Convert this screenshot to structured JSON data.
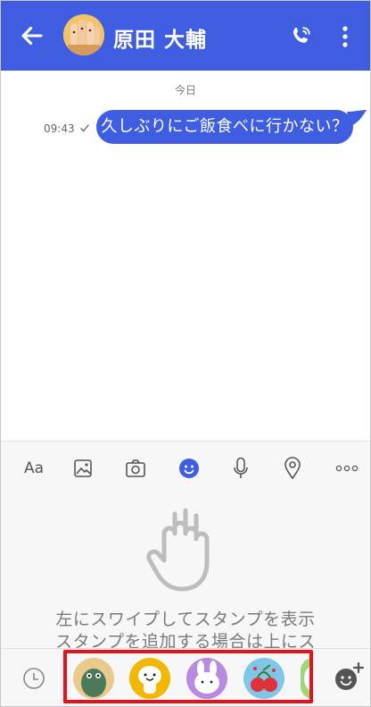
{
  "header": {
    "contact_name": "原田 大輔",
    "icons": [
      "back-arrow-icon",
      "avatar",
      "phone-call-icon",
      "more-vertical-icon"
    ]
  },
  "chat": {
    "date_label": "今日",
    "messages": [
      {
        "time": "09:43",
        "text": "久しぶりにご飯食べに行かない？",
        "sent": true,
        "read_mark": "check-icon"
      }
    ]
  },
  "toolbar": {
    "text_label": "Aa",
    "icons": [
      "text-format",
      "image-icon",
      "camera-icon",
      "emoji-icon",
      "microphone-icon",
      "location-pin-icon",
      "more-horizontal-icon"
    ],
    "active": "emoji-icon"
  },
  "sticker_panel": {
    "hint_line1": "左にスワイプしてスタンプを表示",
    "hint_line2": "スタンプを追加する場合は上にス"
  },
  "sticker_tabs": {
    "items": [
      "recent-clock-icon",
      "sticker-pack-1",
      "sticker-pack-2",
      "sticker-pack-3",
      "sticker-pack-4",
      "sticker-pack-5",
      "add-sticker-icon"
    ],
    "highlight_color": "#e5121b"
  },
  "colors": {
    "accent": "#3f5de0",
    "highlight": "#e5121b"
  }
}
